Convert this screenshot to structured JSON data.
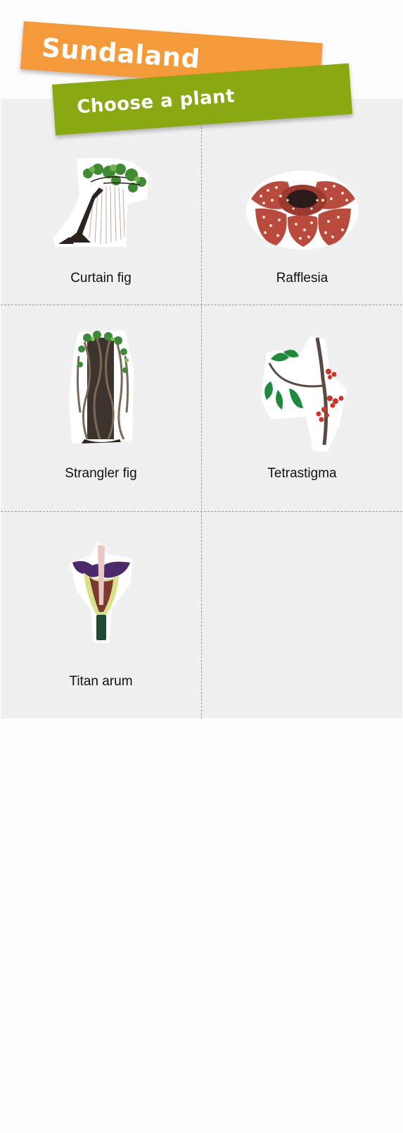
{
  "header": {
    "title": "Sundaland",
    "subtitle": "Choose a plant"
  },
  "colors": {
    "banner_orange": "#f59a3a",
    "banner_green": "#8aa811",
    "grid_background": "#f0f0f0",
    "page_background": "#fdfdfd"
  },
  "plants": [
    {
      "label": "Curtain fig",
      "icon": "curtain-fig-icon"
    },
    {
      "label": "Rafflesia",
      "icon": "rafflesia-icon"
    },
    {
      "label": "Strangler fig",
      "icon": "strangler-fig-icon"
    },
    {
      "label": "Tetrastigma",
      "icon": "tetrastigma-icon"
    },
    {
      "label": "Titan arum",
      "icon": "titan-arum-icon"
    }
  ]
}
